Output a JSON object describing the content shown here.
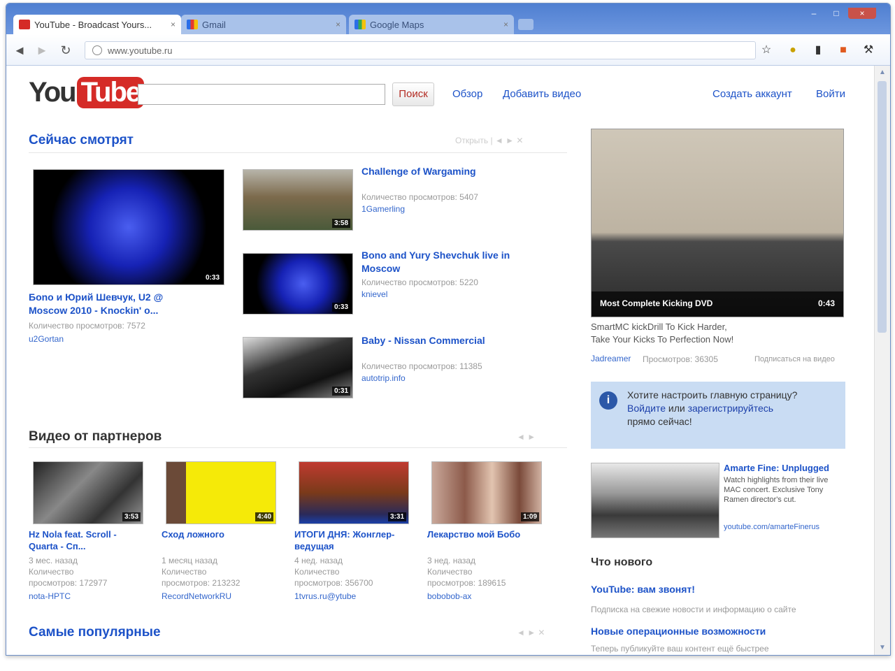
{
  "browser": {
    "tabs": [
      {
        "title": "YouTube - Broadcast Yours...",
        "close": "×"
      },
      {
        "title": "Gmail",
        "close": "×"
      },
      {
        "title": "Google Maps",
        "close": "×"
      }
    ],
    "new_tab": "+",
    "address": "www.youtube.ru",
    "nav": {
      "back": "◄",
      "forward": "►",
      "reload": "↻"
    },
    "window_controls": {
      "minimize": "–",
      "maximize": "□",
      "close": "×"
    }
  },
  "header": {
    "logo_you": "You",
    "logo_tube": "Tube",
    "search_placeholder": "",
    "search_button": "Поиск",
    "nav_browse": "Обзор",
    "nav_upload": "Добавить видео",
    "create_account": "Создать аккаунт",
    "sign_in": "Войти"
  },
  "watching_now": {
    "title": "Сейчас смотрят",
    "controls": "Открыть  |  ◄ ►  ✕",
    "featured": {
      "title": "Бono и Юрий Шевчук, U2 @ Moscow 2010 - Knockin' o...",
      "views": "Количество просмотров: 7572",
      "user": "u2Gortan",
      "duration": "0:33"
    },
    "list": [
      {
        "title": "Challenge of Wargaming",
        "views": "Количество просмотров: 5407",
        "user": "1Gamerling",
        "duration": "3:58"
      },
      {
        "title": "Bono and Yury Shevchuk live in Moscow",
        "views": "Количество просмотров: 5220",
        "user": "knievel",
        "duration": "0:33"
      },
      {
        "title": "Baby - Nissan Commercial",
        "views": "Количество просмотров: 11385",
        "user": "autotrip.info",
        "duration": "0:31"
      }
    ]
  },
  "partners": {
    "title": "Видео от партнеров",
    "controls": "◄ ►",
    "videos": [
      {
        "title": "Hz Nola feat. Scroll - Quarta - Сп...",
        "meta1": "3 мес. назад",
        "meta2": "Количество",
        "meta3": "просмотров: 172977",
        "user": "nota-HPTC",
        "duration": "3:53"
      },
      {
        "title": "Сход ложного",
        "meta1": "1 месяц назад",
        "meta2": "Количество",
        "meta3": "просмотров: 213232",
        "user": "RecordNetworkRU",
        "duration": "4:40"
      },
      {
        "title": "ИТОГИ ДНЯ: Жонглер-ведущая",
        "meta1": "4 нед. назад",
        "meta2": "Количество",
        "meta3": "просмотров: 356700",
        "user": "1tvrus.ru@ytube",
        "duration": "3:31"
      },
      {
        "title": "Лекарство мой Бобо",
        "meta1": "3 нед. назад",
        "meta2": "Количество",
        "meta3": "просмотров: 189615",
        "user": "bobobob-ax",
        "duration": "1:09"
      }
    ]
  },
  "popular": {
    "title": "Самые популярные",
    "controls": "◄ ►  ✕"
  },
  "sidebar": {
    "ad_video": {
      "caption": "Most Complete Kicking DVD",
      "duration": "0:43",
      "desc1": "SmartMC kickDrill To Kick Harder,",
      "desc2": "Take Your Kicks To Perfection Now!",
      "user": "Jadreamer",
      "views": "Просмотров: 36305",
      "label": "Подписаться на видео"
    },
    "info": {
      "icon": "i",
      "line1": "Хотите настроить главную страницу?",
      "link_signin": "Войдите",
      "or": "или",
      "link_register": "зарегистрируйтесь",
      "line3": "прямо сейчас!"
    },
    "promo": {
      "title": "Amarte Fine: Unplugged",
      "text": "Watch highlights from their live MAC concert. Exclusive Tony Ramen director's cut.",
      "link": "youtube.com/amarteFinerus"
    },
    "whats_new": {
      "title": "Что нового",
      "item1_title": "YouTube: вам звонят!",
      "item1_text": "Подписка на свежие новости и информацию о сайте",
      "item2_title": "Новые операционные возможности",
      "item2_text": "Теперь публикуйте ваш контент ещё быстрее"
    }
  }
}
